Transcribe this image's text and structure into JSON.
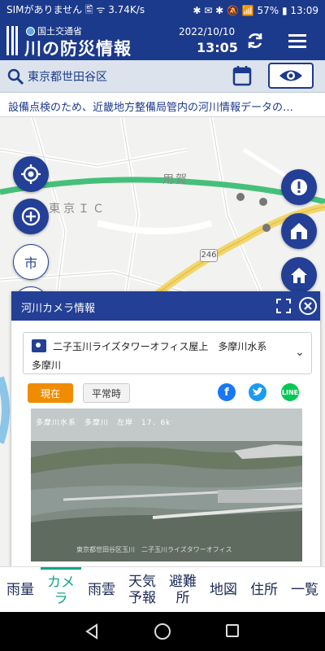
{
  "status_bar": {
    "left_text": "SIMがありません 🖺 ᯤ 3.74K/s",
    "right_text": "✱ ✉ ✱ 🔕 📶 57% ▮ 13:09"
  },
  "header": {
    "ministry": "国土交通省",
    "app_title": "川の防災情報",
    "date": "2022/10/10",
    "time": "13:05"
  },
  "search": {
    "location": "東京都世田谷区"
  },
  "notice": {
    "text": "設備点検のため、近畿地方整備局管内の河川情報データの…"
  },
  "map": {
    "labels": {
      "youga": "用賀",
      "tokyo_ic": "東京ＩＣ",
      "route": "246"
    },
    "city_button": "市"
  },
  "panel": {
    "title": "河川カメラ情報",
    "camera_name_line1": "二子玉川ライズタワーオフィス屋上　多摩川水系",
    "camera_name_line2": "多摩川",
    "btn_now": "現在",
    "btn_normal": "平常時",
    "image_caption": "多摩川水系　多摩川　左岸　17．6k",
    "image_bottom_caption": "東京都世田谷区玉川　二子玉川ライズタワーオフィス"
  },
  "tabs": [
    {
      "label": "雨量"
    },
    {
      "label": "カメ\nラ",
      "active": true
    },
    {
      "label": "雨雲"
    },
    {
      "label": "天気\n予報"
    },
    {
      "label": "避難\n所"
    },
    {
      "label": "地図"
    },
    {
      "label": "住所"
    },
    {
      "label": "一覧"
    }
  ],
  "colors": {
    "brand_blue": "#1c3a8c",
    "accent_teal": "#14a58a",
    "now_orange": "#f08c00"
  }
}
